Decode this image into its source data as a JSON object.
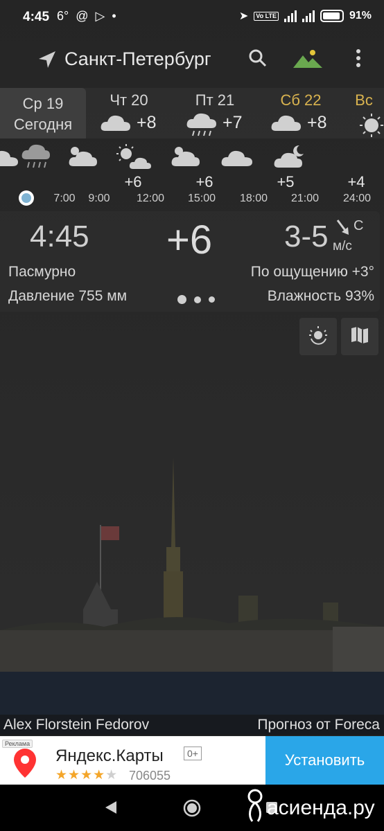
{
  "status_bar": {
    "time": "4:45",
    "temp_icon": "6°",
    "battery": "91%"
  },
  "header": {
    "city": "Санкт-Петербург",
    "location_icon": "navigation-arrow-icon",
    "search_icon": "search-icon",
    "background_icon": "landscape-icon",
    "more_icon": "more-vert-icon"
  },
  "days": [
    {
      "name": "Ср 19",
      "sub": "Сегодня",
      "active": true
    },
    {
      "name": "Чт 20",
      "temp": "+8",
      "icon": "cloud-icon"
    },
    {
      "name": "Пт 21",
      "temp": "+7",
      "icon": "rain-cloud-icon"
    },
    {
      "name": "Сб 22",
      "temp": "+8",
      "icon": "cloud-icon",
      "weekend": true
    },
    {
      "name": "Вс",
      "icon": "sun-icon",
      "weekend": true
    }
  ],
  "hourly": {
    "times": [
      "7:00",
      "9:00",
      "12:00",
      "15:00",
      "18:00",
      "21:00",
      "24:00"
    ],
    "temps": [
      {
        "time": "12:00",
        "temp": "+6"
      },
      {
        "time": "15:00",
        "temp": "+6"
      },
      {
        "time": "21:00",
        "temp": "+5"
      },
      {
        "time": "24:00",
        "temp": "+4"
      }
    ]
  },
  "current": {
    "time": "4:45",
    "temp": "+6",
    "wind": "3-5",
    "wind_dir": "С",
    "wind_unit": "м/с",
    "condition": "Пасмурно",
    "feels_like": "По ощущению +3°",
    "pressure": "Давление 755 мм",
    "humidity": "Влажность 93%"
  },
  "credits": {
    "photo": "Alex Florstein Fedorov",
    "forecast": "Прогноз от Foreca"
  },
  "ad": {
    "tag": "Реклама",
    "title": "Яндекс.Карты",
    "age": "0+",
    "rating": 4,
    "count": "706055",
    "install": "Установить"
  },
  "watermark": "асиенда.ру",
  "colors": {
    "weekend": "#d9b34f",
    "install_bg": "#2aa6e8",
    "now_dot": "#7fb3d3"
  }
}
